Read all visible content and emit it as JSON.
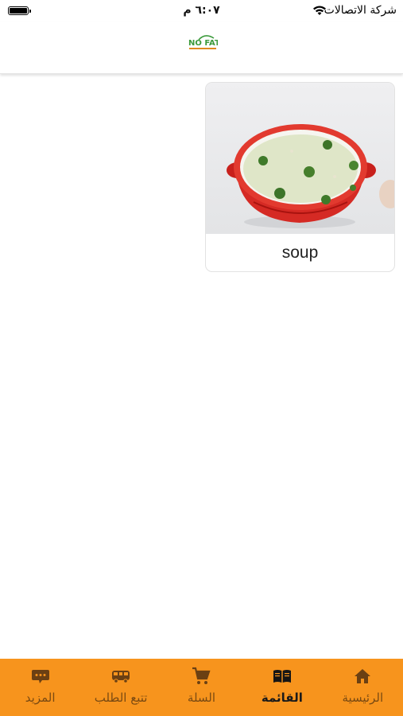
{
  "status_bar": {
    "carrier": "شركة الاتصالات",
    "time": "٦:٠٧ م"
  },
  "header": {
    "logo_text": "NO FAT"
  },
  "products": [
    {
      "name": "soup",
      "image_icon": "soup-bowl-image"
    }
  ],
  "tabbar": {
    "accent_color": "#f7941d",
    "items": [
      {
        "label": "الرئيسية",
        "icon": "home-icon",
        "active": false
      },
      {
        "label": "القائمة",
        "icon": "menu-book-icon",
        "active": true
      },
      {
        "label": "السلة",
        "icon": "cart-icon",
        "active": false
      },
      {
        "label": "تتبع الطلب",
        "icon": "truck-icon",
        "active": false
      },
      {
        "label": "المزيد",
        "icon": "more-icon",
        "active": false
      }
    ]
  }
}
